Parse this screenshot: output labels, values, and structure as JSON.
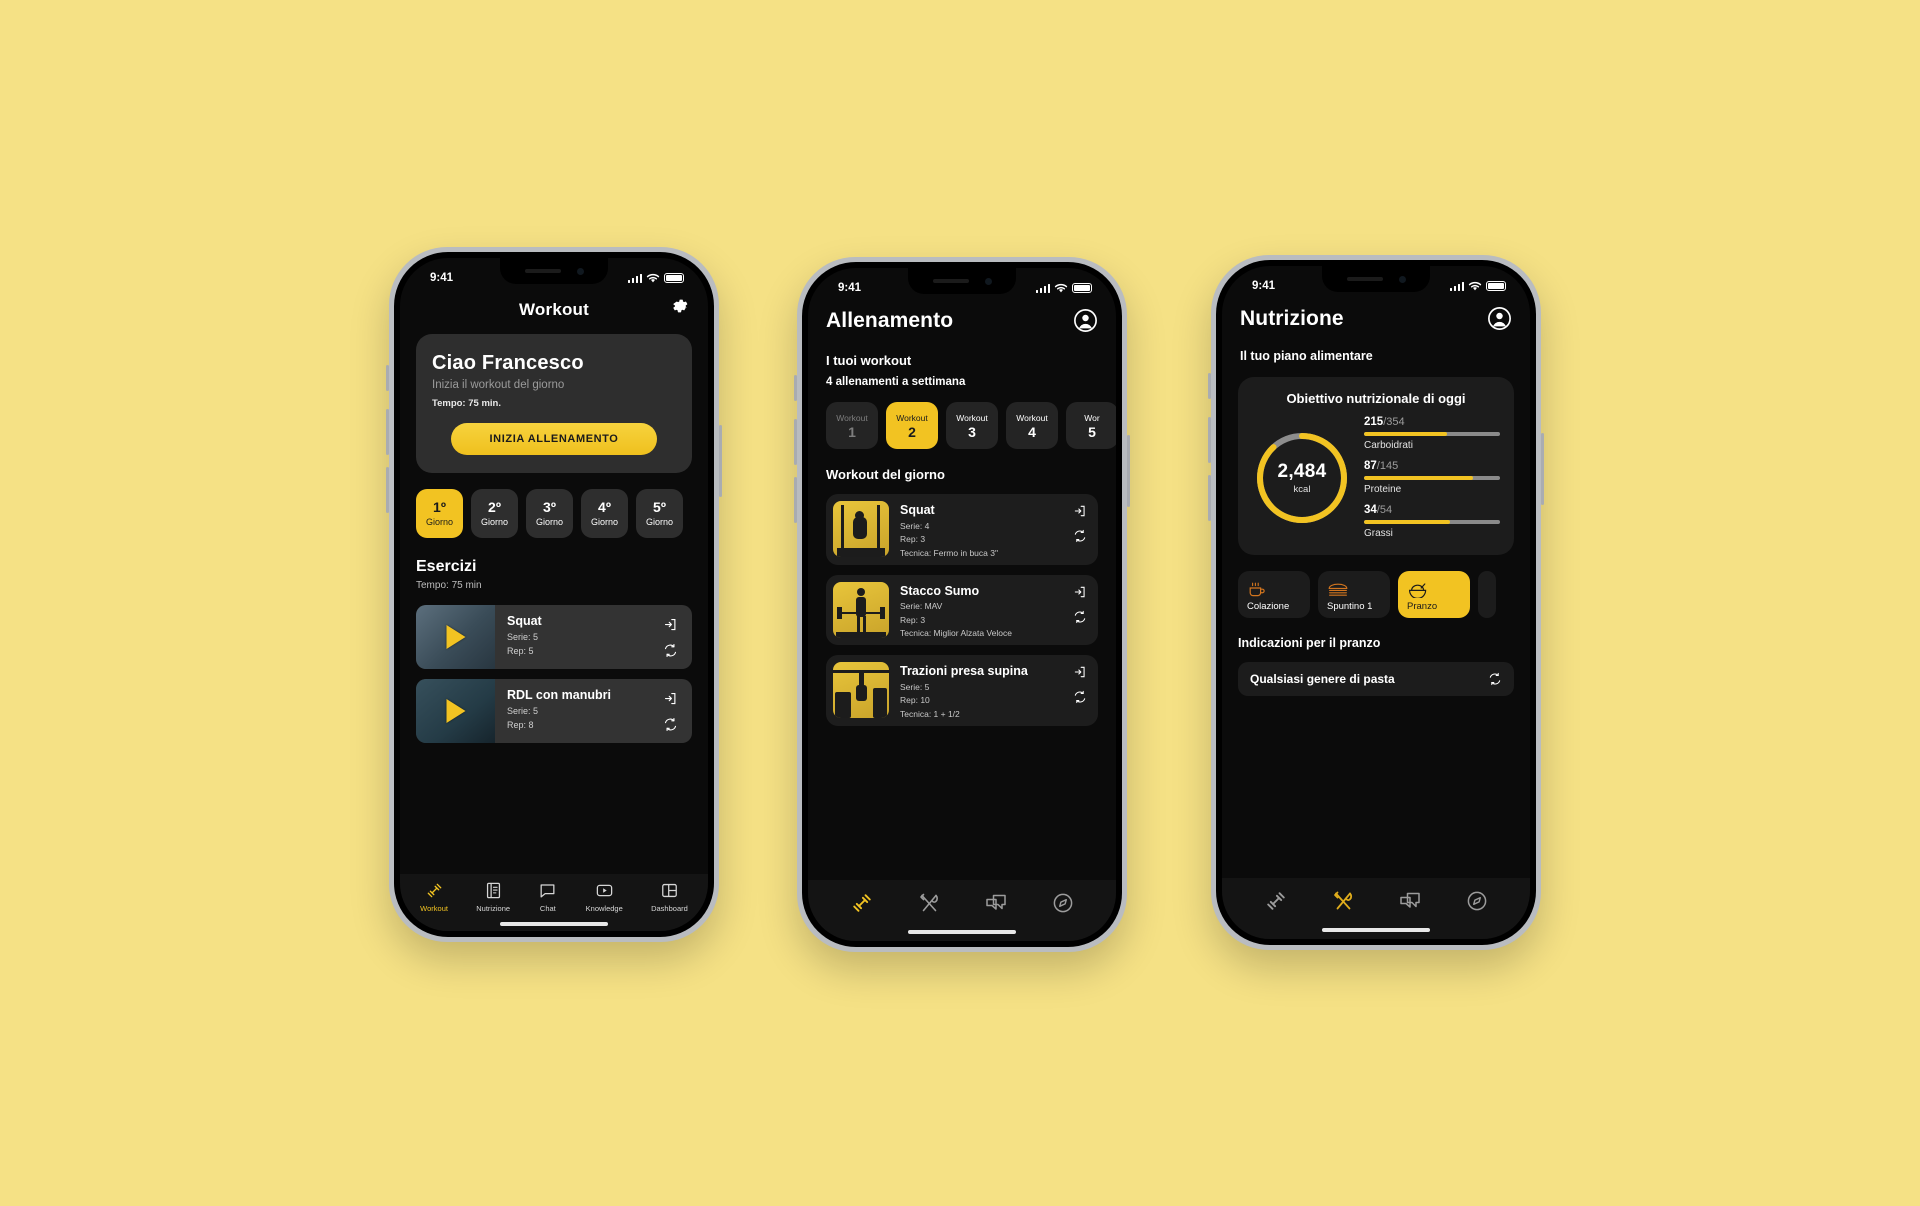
{
  "background_color": "#f5e185",
  "accent_color": "#f2c322",
  "phone1": {
    "status": {
      "time": "9:41"
    },
    "header": {
      "title": "Workout",
      "settings_icon": "gear-icon"
    },
    "hero": {
      "greeting": "Ciao Francesco",
      "subtitle": "Inizia il workout del giorno",
      "tempo": "Tempo: 75 min.",
      "cta": "INIZIA ALLENAMENTO"
    },
    "days": [
      {
        "n": "1º",
        "label": "Giorno",
        "active": true
      },
      {
        "n": "2º",
        "label": "Giorno",
        "active": false
      },
      {
        "n": "3º",
        "label": "Giorno",
        "active": false
      },
      {
        "n": "4º",
        "label": "Giorno",
        "active": false
      },
      {
        "n": "5º",
        "label": "Giorno",
        "active": false
      }
    ],
    "section": {
      "title": "Esercizi",
      "subtitle": "Tempo: 75 min"
    },
    "exercises": [
      {
        "name": "Squat",
        "serie": "Serie: 5",
        "rep": "Rep: 5"
      },
      {
        "name": "RDL con manubri",
        "serie": "Serie: 5",
        "rep": "Rep: 8"
      }
    ],
    "tabs": [
      {
        "label": "Workout",
        "icon": "dumbbell-icon",
        "active": true
      },
      {
        "label": "Nutrizione",
        "icon": "book-icon",
        "active": false
      },
      {
        "label": "Chat",
        "icon": "chat-bubble-icon",
        "active": false
      },
      {
        "label": "Knowledge",
        "icon": "video-play-icon",
        "active": false
      },
      {
        "label": "Dashboard",
        "icon": "dashboard-grid-icon",
        "active": false
      }
    ]
  },
  "phone2": {
    "status": {
      "time": "9:41"
    },
    "header": {
      "title": "Allenamento",
      "avatar_icon": "user-avatar-icon"
    },
    "sub1": "I tuoi workout",
    "sub2": "4 allenamenti a settimana",
    "workout_tabs": [
      {
        "t": "Workout",
        "n": "1",
        "active": false,
        "dim": true
      },
      {
        "t": "Workout",
        "n": "2",
        "active": true,
        "dim": false
      },
      {
        "t": "Workout",
        "n": "3",
        "active": false,
        "dim": false
      },
      {
        "t": "Workout",
        "n": "4",
        "active": false,
        "dim": false
      },
      {
        "t": "Wor",
        "n": "5",
        "active": false,
        "dim": false
      }
    ],
    "section": "Workout del giorno",
    "exercises": [
      {
        "name": "Squat",
        "serie": "Serie: 4",
        "rep": "Rep: 3",
        "tecnica": "Tecnica: Fermo in buca 3\""
      },
      {
        "name": "Stacco Sumo",
        "serie": "Serie: MAV",
        "rep": "Rep: 3",
        "tecnica": "Tecnica: Miglior Alzata Veloce"
      },
      {
        "name": "Trazioni presa supina",
        "serie": "Serie: 5",
        "rep": "Rep: 10",
        "tecnica": "Tecnica: 1 + 1/2"
      }
    ],
    "tabs": [
      {
        "icon": "dumbbell-icon",
        "active": true
      },
      {
        "icon": "fork-knife-icon",
        "active": false
      },
      {
        "icon": "chat-bubble-icon",
        "active": false
      },
      {
        "icon": "compass-icon",
        "active": false
      }
    ]
  },
  "phone3": {
    "status": {
      "time": "9:41"
    },
    "header": {
      "title": "Nutrizione",
      "avatar_icon": "user-avatar-icon"
    },
    "sub": "Il tuo piano alimentare",
    "goal_card": {
      "title": "Obiettivo nutrizionale di oggi",
      "kcal_value": "2,484",
      "kcal_unit": "kcal",
      "ring_percent": 88,
      "macros": [
        {
          "current": "215",
          "total": "/354",
          "label": "Carboidrati",
          "percent": 61
        },
        {
          "current": "87",
          "total": "/145",
          "label": "Proteine",
          "percent": 80
        },
        {
          "current": "34",
          "total": "/54",
          "label": "Grassi",
          "percent": 63
        }
      ]
    },
    "meals": [
      {
        "label": "Colazione",
        "icon": "coffee-cup-icon",
        "active": false
      },
      {
        "label": "Spuntino 1",
        "icon": "sandwich-icon",
        "active": false
      },
      {
        "label": "Pranzo",
        "icon": "rice-bowl-icon",
        "active": true
      }
    ],
    "section": "Indicazioni per il pranzo",
    "food_row": {
      "name": "Qualsiasi genere di pasta",
      "action_icon": "refresh-icon"
    },
    "tabs": [
      {
        "icon": "dumbbell-icon",
        "active": false
      },
      {
        "icon": "fork-knife-icon",
        "active": true
      },
      {
        "icon": "chat-bubble-icon",
        "active": false
      },
      {
        "icon": "compass-icon",
        "active": false
      }
    ]
  }
}
